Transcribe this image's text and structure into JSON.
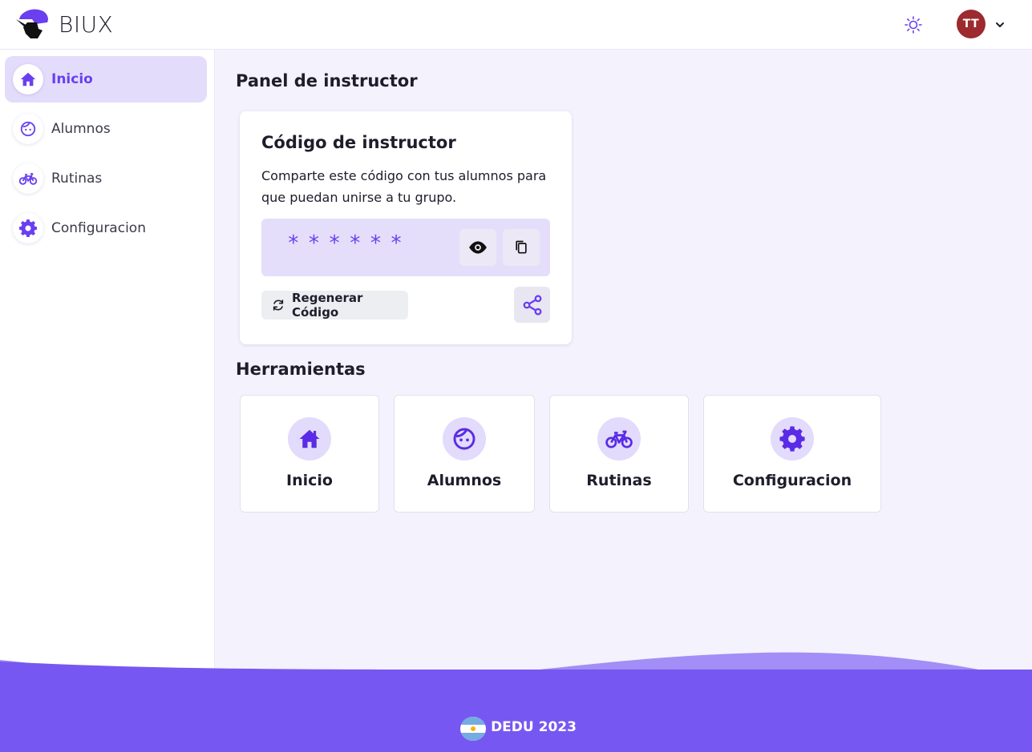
{
  "header": {
    "brand": "BIUX",
    "avatar_initials": "TT"
  },
  "sidebar": {
    "items": [
      {
        "label": "Inicio",
        "icon": "home-icon",
        "active": true
      },
      {
        "label": "Alumnos",
        "icon": "face-icon",
        "active": false
      },
      {
        "label": "Rutinas",
        "icon": "bike-icon",
        "active": false
      },
      {
        "label": "Configuracion",
        "icon": "gear-icon",
        "active": false
      }
    ]
  },
  "main": {
    "title": "Panel de instructor",
    "code_card": {
      "title": "Código de instructor",
      "description": "Comparte este código con tus alumnos para que puedan unirse a tu grupo.",
      "masked_code": "******",
      "regenerate_label": "Regenerar Código"
    },
    "tools_title": "Herramientas",
    "tools": [
      {
        "label": "Inicio",
        "icon": "home-icon"
      },
      {
        "label": "Alumnos",
        "icon": "face-icon"
      },
      {
        "label": "Rutinas",
        "icon": "bike-icon"
      },
      {
        "label": "Configuracion",
        "icon": "gear-icon"
      }
    ]
  },
  "footer": {
    "text": "DEDU 2023"
  },
  "colors": {
    "accent": "#6a3ff0",
    "accent_light": "#e3ddfb",
    "footer": "#7757f1",
    "avatar": "#9c2a2e"
  }
}
